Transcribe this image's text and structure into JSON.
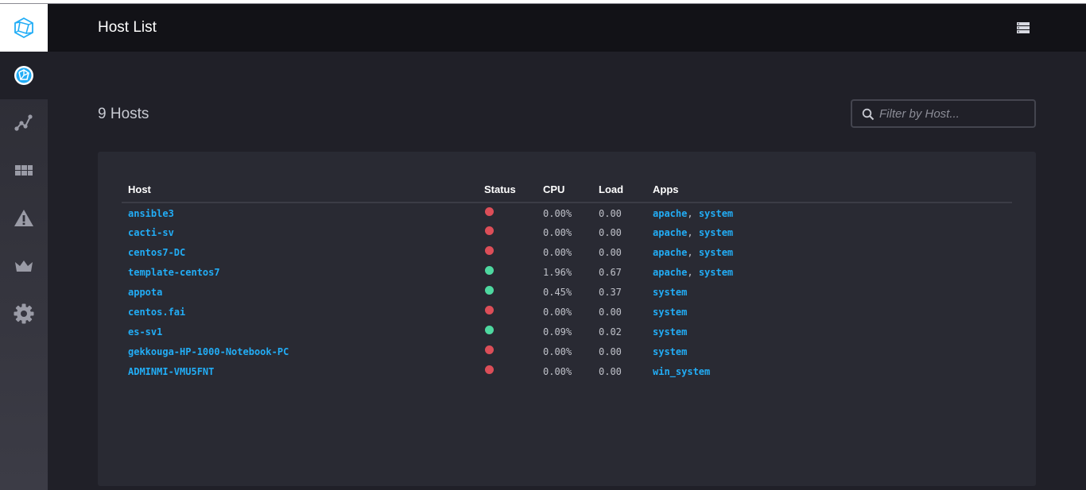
{
  "sidebar": {
    "logo_icon": "chronograf-logo-icon",
    "items": [
      {
        "icon": "host-status-icon",
        "active": true
      },
      {
        "icon": "graph-icon",
        "active": false
      },
      {
        "icon": "dashboards-icon",
        "active": false
      },
      {
        "icon": "alert-icon",
        "active": false
      },
      {
        "icon": "crown-icon",
        "active": false
      },
      {
        "icon": "gear-icon",
        "active": false
      }
    ]
  },
  "header": {
    "title": "Host List",
    "menu_icon": "server-list-icon"
  },
  "main": {
    "host_count": "9 Hosts",
    "filter_placeholder": "Filter by Host..."
  },
  "colors": {
    "online": "#4ed8a0",
    "offline": "#dc4e58",
    "link": "#22adf6"
  },
  "table": {
    "headers": {
      "host": "Host",
      "status": "Status",
      "cpu": "CPU",
      "load": "Load",
      "apps": "Apps"
    },
    "rows": [
      {
        "host": "ansible3",
        "status": "offline",
        "cpu": "0.00%",
        "load": "0.00",
        "apps": [
          "apache",
          "system"
        ]
      },
      {
        "host": "cacti-sv",
        "status": "offline",
        "cpu": "0.00%",
        "load": "0.00",
        "apps": [
          "apache",
          "system"
        ]
      },
      {
        "host": "centos7-DC",
        "status": "offline",
        "cpu": "0.00%",
        "load": "0.00",
        "apps": [
          "apache",
          "system"
        ]
      },
      {
        "host": "template-centos7",
        "status": "online",
        "cpu": "1.96%",
        "load": "0.67",
        "apps": [
          "apache",
          "system"
        ]
      },
      {
        "host": "appota",
        "status": "online",
        "cpu": "0.45%",
        "load": "0.37",
        "apps": [
          "system"
        ]
      },
      {
        "host": "centos.fai",
        "status": "offline",
        "cpu": "0.00%",
        "load": "0.00",
        "apps": [
          "system"
        ]
      },
      {
        "host": "es-sv1",
        "status": "online",
        "cpu": "0.09%",
        "load": "0.02",
        "apps": [
          "system"
        ]
      },
      {
        "host": "gekkouga-HP-1000-Notebook-PC",
        "status": "offline",
        "cpu": "0.00%",
        "load": "0.00",
        "apps": [
          "system"
        ]
      },
      {
        "host": "ADMINMI-VMU5FNT",
        "status": "offline",
        "cpu": "0.00%",
        "load": "0.00",
        "apps": [
          "win_system"
        ]
      }
    ]
  }
}
